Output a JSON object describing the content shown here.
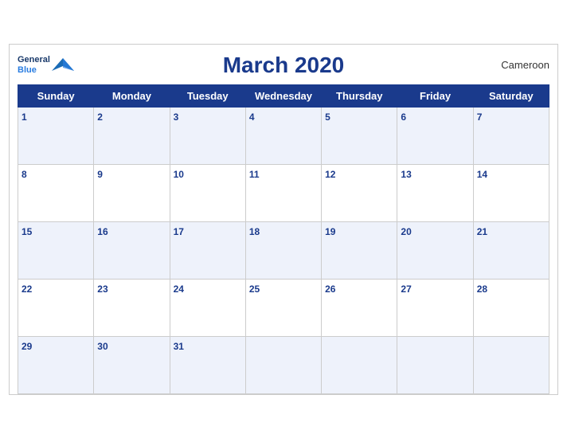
{
  "header": {
    "logo_general": "General",
    "logo_blue": "Blue",
    "title": "March 2020",
    "country": "Cameroon"
  },
  "weekdays": [
    "Sunday",
    "Monday",
    "Tuesday",
    "Wednesday",
    "Thursday",
    "Friday",
    "Saturday"
  ],
  "weeks": [
    [
      {
        "day": "1",
        "active": true
      },
      {
        "day": "2",
        "active": true
      },
      {
        "day": "3",
        "active": true
      },
      {
        "day": "4",
        "active": true
      },
      {
        "day": "5",
        "active": true
      },
      {
        "day": "6",
        "active": true
      },
      {
        "day": "7",
        "active": true
      }
    ],
    [
      {
        "day": "8",
        "active": true
      },
      {
        "day": "9",
        "active": true
      },
      {
        "day": "10",
        "active": true
      },
      {
        "day": "11",
        "active": true
      },
      {
        "day": "12",
        "active": true
      },
      {
        "day": "13",
        "active": true
      },
      {
        "day": "14",
        "active": true
      }
    ],
    [
      {
        "day": "15",
        "active": true
      },
      {
        "day": "16",
        "active": true
      },
      {
        "day": "17",
        "active": true
      },
      {
        "day": "18",
        "active": true
      },
      {
        "day": "19",
        "active": true
      },
      {
        "day": "20",
        "active": true
      },
      {
        "day": "21",
        "active": true
      }
    ],
    [
      {
        "day": "22",
        "active": true
      },
      {
        "day": "23",
        "active": true
      },
      {
        "day": "24",
        "active": true
      },
      {
        "day": "25",
        "active": true
      },
      {
        "day": "26",
        "active": true
      },
      {
        "day": "27",
        "active": true
      },
      {
        "day": "28",
        "active": true
      }
    ],
    [
      {
        "day": "29",
        "active": true
      },
      {
        "day": "30",
        "active": true
      },
      {
        "day": "31",
        "active": true
      },
      {
        "day": "",
        "active": false
      },
      {
        "day": "",
        "active": false
      },
      {
        "day": "",
        "active": false
      },
      {
        "day": "",
        "active": false
      }
    ]
  ]
}
